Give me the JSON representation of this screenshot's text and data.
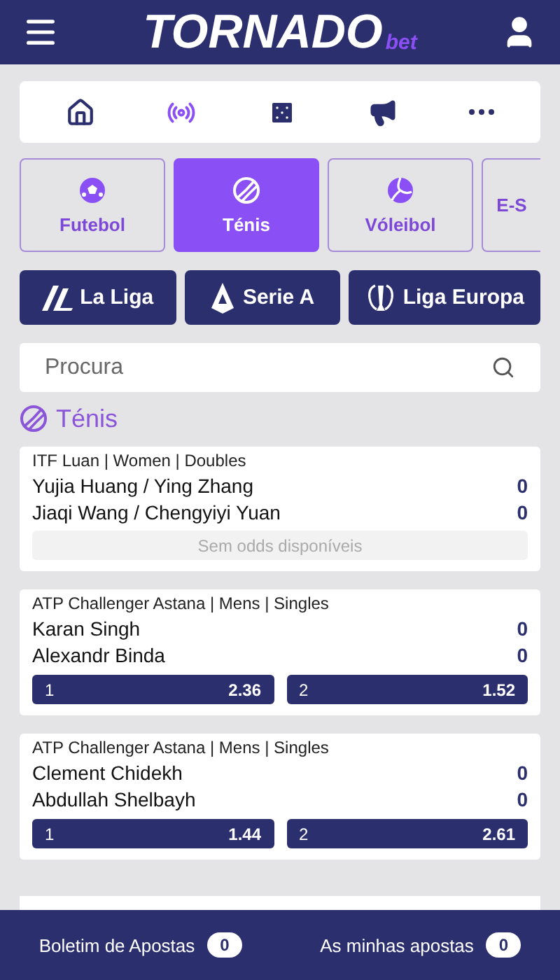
{
  "header": {
    "logo": "TORNADO",
    "logo_suffix": "bet"
  },
  "quick_nav": [
    {
      "kind": "home",
      "selected": false
    },
    {
      "kind": "live",
      "selected": true
    },
    {
      "kind": "casino",
      "selected": false
    },
    {
      "kind": "promo",
      "selected": false
    },
    {
      "kind": "more",
      "selected": false
    }
  ],
  "sports": [
    {
      "kind": "football",
      "label": "Futebol",
      "selected": false
    },
    {
      "kind": "tennis",
      "label": "Ténis",
      "selected": true
    },
    {
      "kind": "volleyball",
      "label": "Vóleibol",
      "selected": false
    },
    {
      "kind": "esports",
      "label": "E-S",
      "selected": false
    }
  ],
  "leagues": [
    {
      "kind": "laliga",
      "label": "La Liga"
    },
    {
      "kind": "seriea",
      "label": "Serie A"
    },
    {
      "kind": "europa",
      "label": "Liga Europa"
    }
  ],
  "search": {
    "placeholder": "Procura"
  },
  "section_title": "Ténis",
  "matches": [
    {
      "competition": "ITF Luan | Women | Doubles",
      "teams": [
        {
          "name": "Yujia Huang / Ying Zhang",
          "score": "0"
        },
        {
          "name": "Jiaqi Wang / Chengyiyi Yuan",
          "score": "0"
        }
      ],
      "no_odds": "Sem odds disponíveis"
    },
    {
      "competition": "ATP Challenger Astana | Mens | Singles",
      "teams": [
        {
          "name": "Karan Singh",
          "score": "0"
        },
        {
          "name": "Alexandr Binda",
          "score": "0"
        }
      ],
      "odds": [
        {
          "label": "1",
          "value": "2.36"
        },
        {
          "label": "2",
          "value": "1.52"
        }
      ]
    },
    {
      "competition": "ATP Challenger Astana | Mens | Singles",
      "teams": [
        {
          "name": "Clement Chidekh",
          "score": "0"
        },
        {
          "name": "Abdullah Shelbayh",
          "score": "0"
        }
      ],
      "odds": [
        {
          "label": "1",
          "value": "1.44"
        },
        {
          "label": "2",
          "value": "2.61"
        }
      ]
    }
  ],
  "footer": [
    {
      "label": "Boletim de Apostas",
      "count": "0"
    },
    {
      "label": "As minhas apostas",
      "count": "0"
    }
  ]
}
